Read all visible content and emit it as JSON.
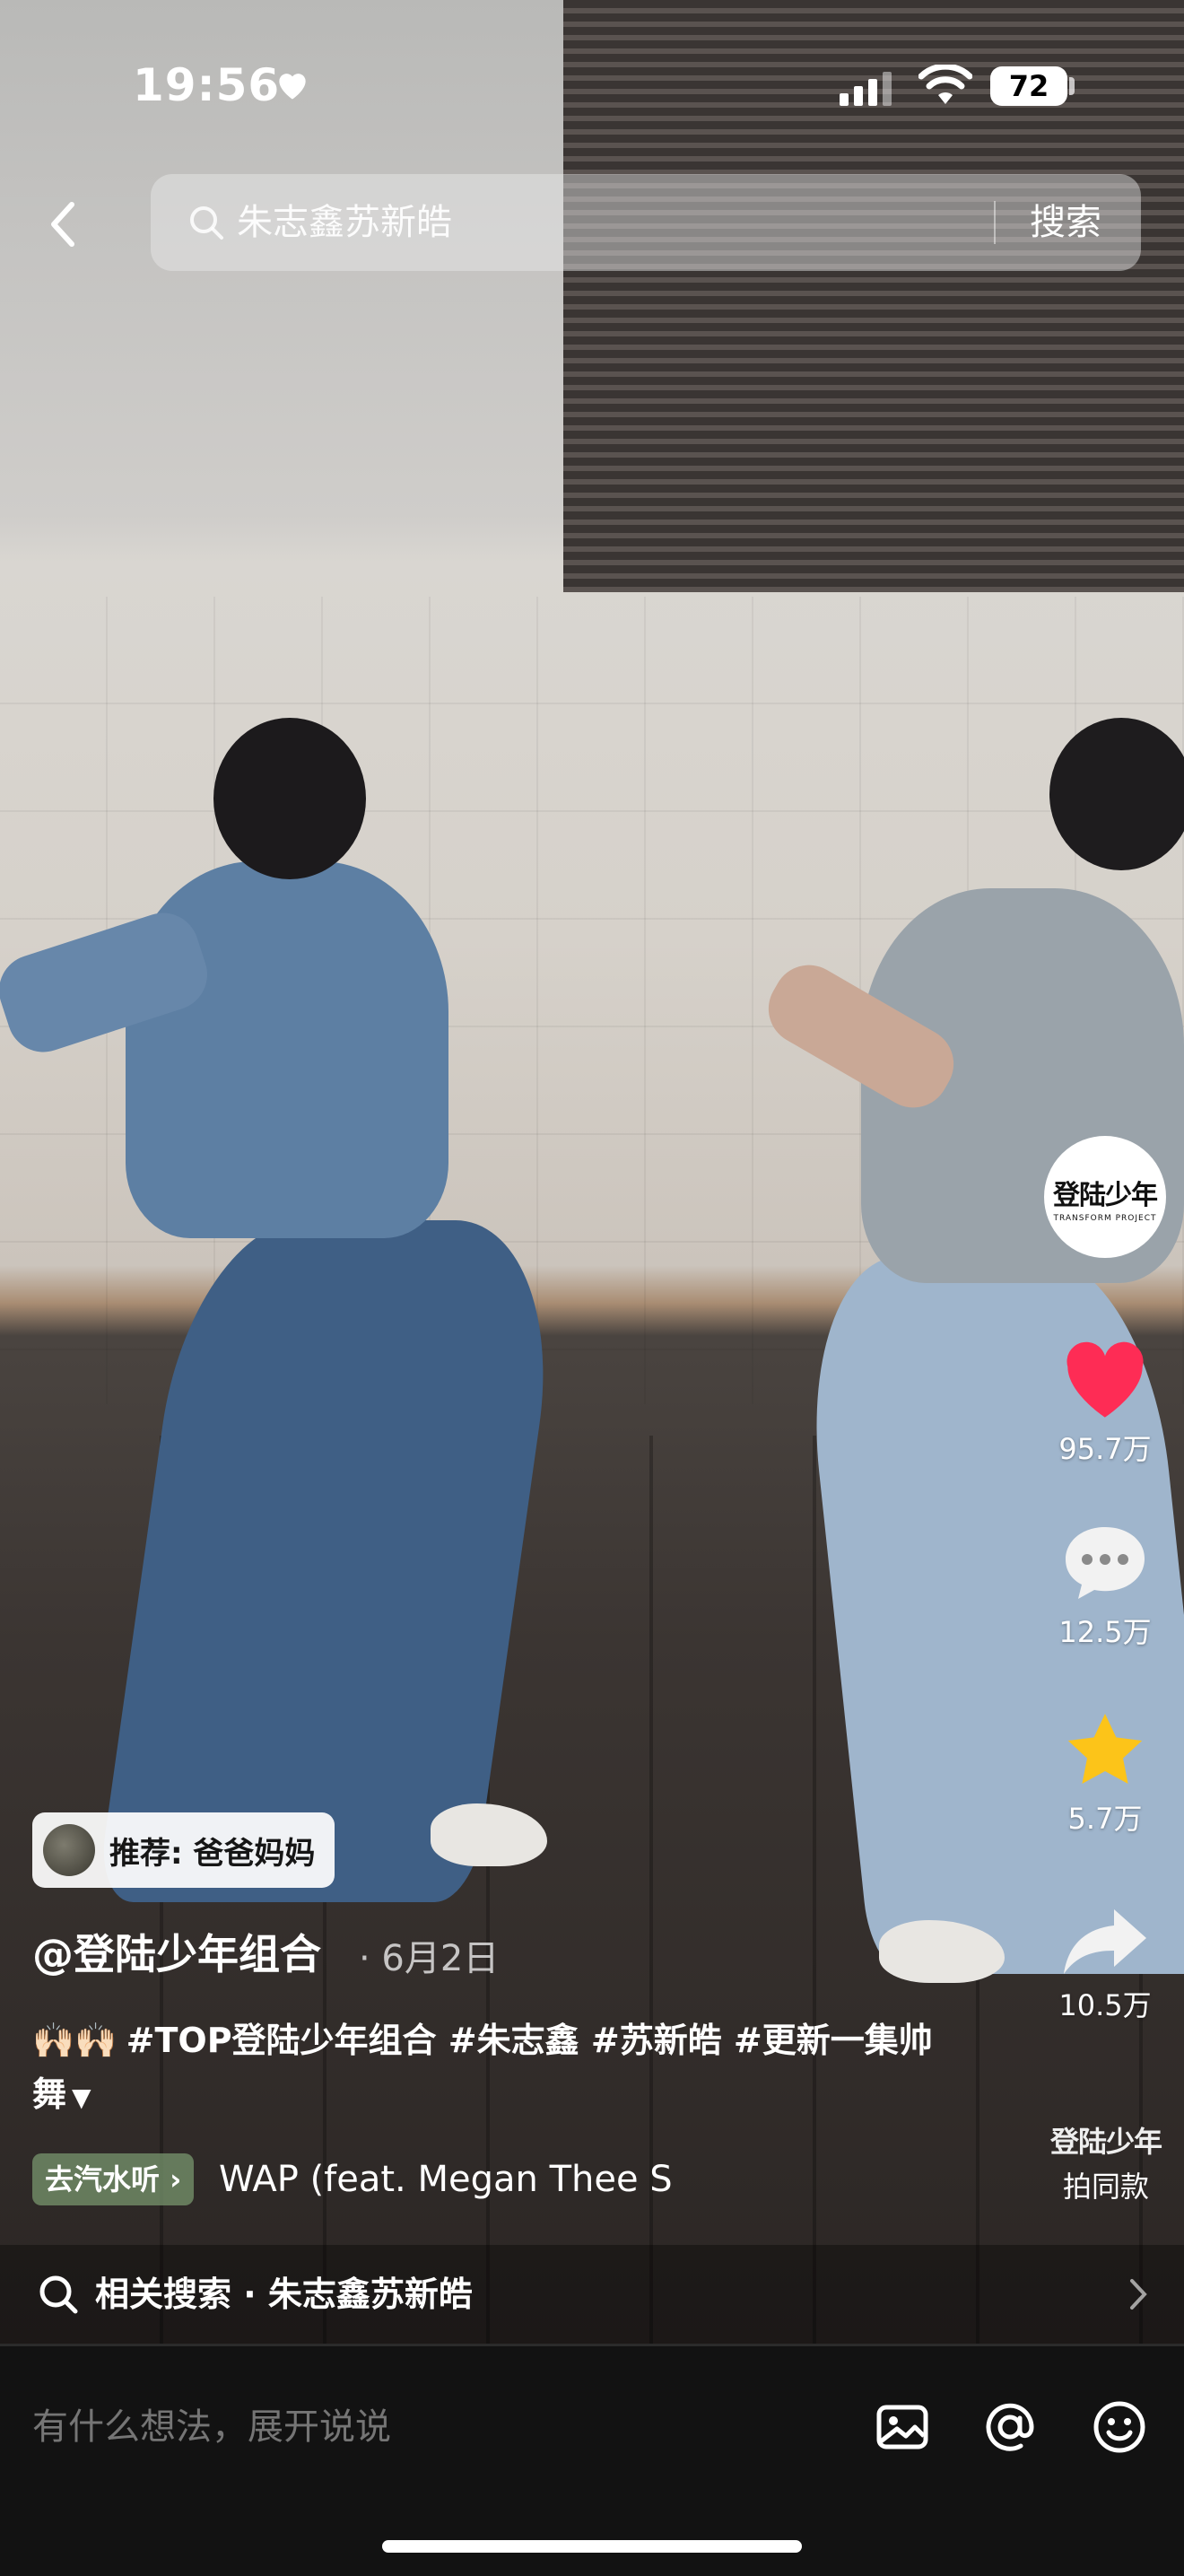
{
  "status_bar": {
    "time": "19:56",
    "battery": "72"
  },
  "search": {
    "query": "朱志鑫苏新皓",
    "button_label": "搜索"
  },
  "creator": {
    "avatar_text": "登陆少年",
    "avatar_sub": "TRANSFORM PROJECT"
  },
  "actions": {
    "likes": "95.7万",
    "comments": "12.5万",
    "favorites": "5.7万",
    "shares": "10.5万",
    "same_style_logo": "登陆少年",
    "same_style_label": "拍同款"
  },
  "recommendation": {
    "text": "推荐: 爸爸妈妈"
  },
  "post": {
    "author": "@登陆少年组合",
    "date": "· 6月2日",
    "caption": "#TOP登陆少年组合 #朱志鑫 #苏新皓 #更新一集帅舞",
    "expand_icon": "chevron-down-icon"
  },
  "music": {
    "chip_label": "去汽水听 ›",
    "title": "WAP (feat. Megan Thee S"
  },
  "related": {
    "text": "相关搜索 · 朱志鑫苏新皓"
  },
  "comment_bar": {
    "placeholder": "有什么想法，展开说说"
  },
  "colors": {
    "like": "#fe2c55",
    "favorite": "#fcc419",
    "bottom_bar": "#121212"
  }
}
